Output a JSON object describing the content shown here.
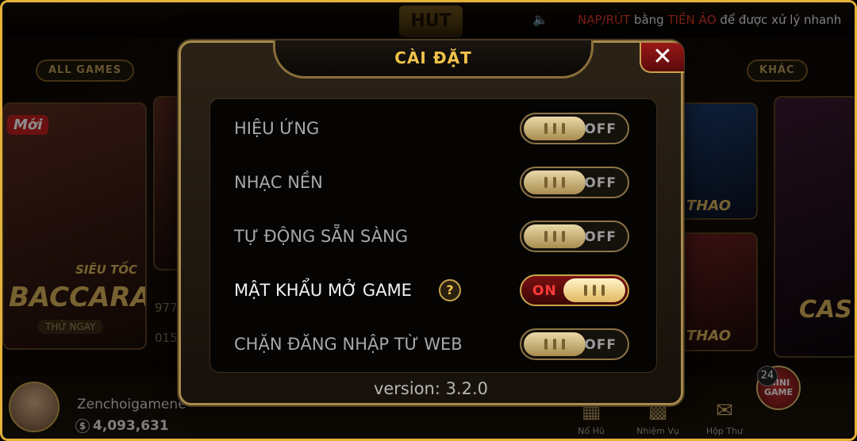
{
  "background": {
    "logo_text": "HUT",
    "ticker": {
      "part1": "NẠP/RÚT",
      "part2": " bằng ",
      "part3": "TIỀN ẢO",
      "part4": " để được xử lý nhanh"
    },
    "tabs": {
      "all_games": "ALL GAMES",
      "other": "KHÁC"
    },
    "cards": {
      "baccarat_badge": "Mới",
      "baccarat_sub": "SIÊU TỐC",
      "baccarat_title": "BACCARAT",
      "try_now": "THỬ NGAY",
      "sport1": "THAO",
      "sport2": "THAO",
      "casino": "CAS"
    },
    "numbers": {
      "n1": "977",
      "n2": "015"
    },
    "user": {
      "name": "Zenchoigamene",
      "coin": "$",
      "balance": "4,093,631"
    },
    "nav": {
      "item1": "Nổ Hũ",
      "item2": "Nhiệm Vụ",
      "item3": "Hộp Thư",
      "mini_game": "MINI GAME",
      "badge": "24"
    }
  },
  "modal": {
    "title": "CÀI ĐẶT",
    "close_label": "✕",
    "settings": [
      {
        "label": "HIỆU ỨNG",
        "state": "OFF"
      },
      {
        "label": "NHẠC NỀN",
        "state": "OFF"
      },
      {
        "label": "TỰ ĐỘNG SẴN SÀNG",
        "state": "OFF"
      },
      {
        "label": "MẬT KHẨU MỞ GAME",
        "state": "ON"
      },
      {
        "label": "CHẶN ĐĂNG NHẬP TỪ WEB",
        "state": "OFF"
      }
    ],
    "help_symbol": "?",
    "version": "version: 3.2.0"
  },
  "colors": {
    "accent_gold": "#f1c24a",
    "on_red": "#ff3a3a",
    "frame": "#e5b23a"
  }
}
